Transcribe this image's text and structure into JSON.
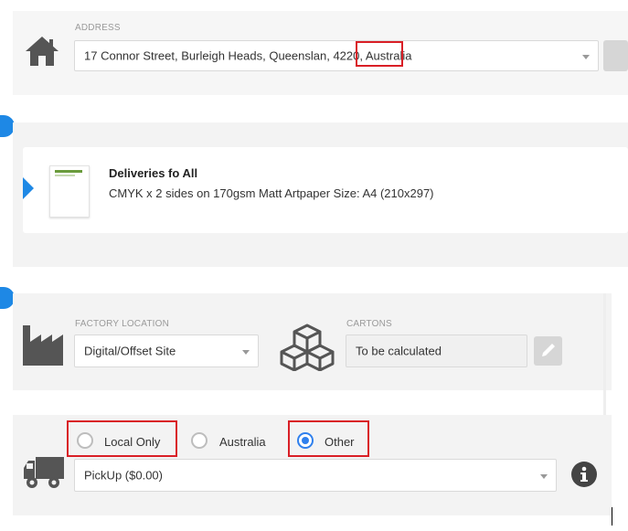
{
  "address": {
    "label": "ADDRESS",
    "value_prefix": "17 Connor Street, Burleigh Heads, Queenslan",
    "value_post": "4220",
    "value_suffix": "Australia",
    "icon": "home-icon"
  },
  "product": {
    "title": "Deliveries fo All",
    "description": "CMYK x 2 sides on 170gsm Matt Artpaper Size: A4 (210x297)"
  },
  "factory": {
    "label": "FACTORY LOCATION",
    "value": "Digital/Offset Site",
    "icon": "factory-icon"
  },
  "cartons": {
    "label": "CARTONS",
    "value": "To be calculated",
    "icon": "boxes-icon"
  },
  "shipping": {
    "options": [
      {
        "label": "Local Only",
        "checked": false
      },
      {
        "label": "Australia",
        "checked": false
      },
      {
        "label": "Other",
        "checked": true
      }
    ],
    "method": "PickUp ($0.00)",
    "icon": "truck-icon"
  },
  "colors": {
    "accent": "#1e88e5",
    "highlight": "#d91f26",
    "radio_selected": "#2f80ed"
  }
}
